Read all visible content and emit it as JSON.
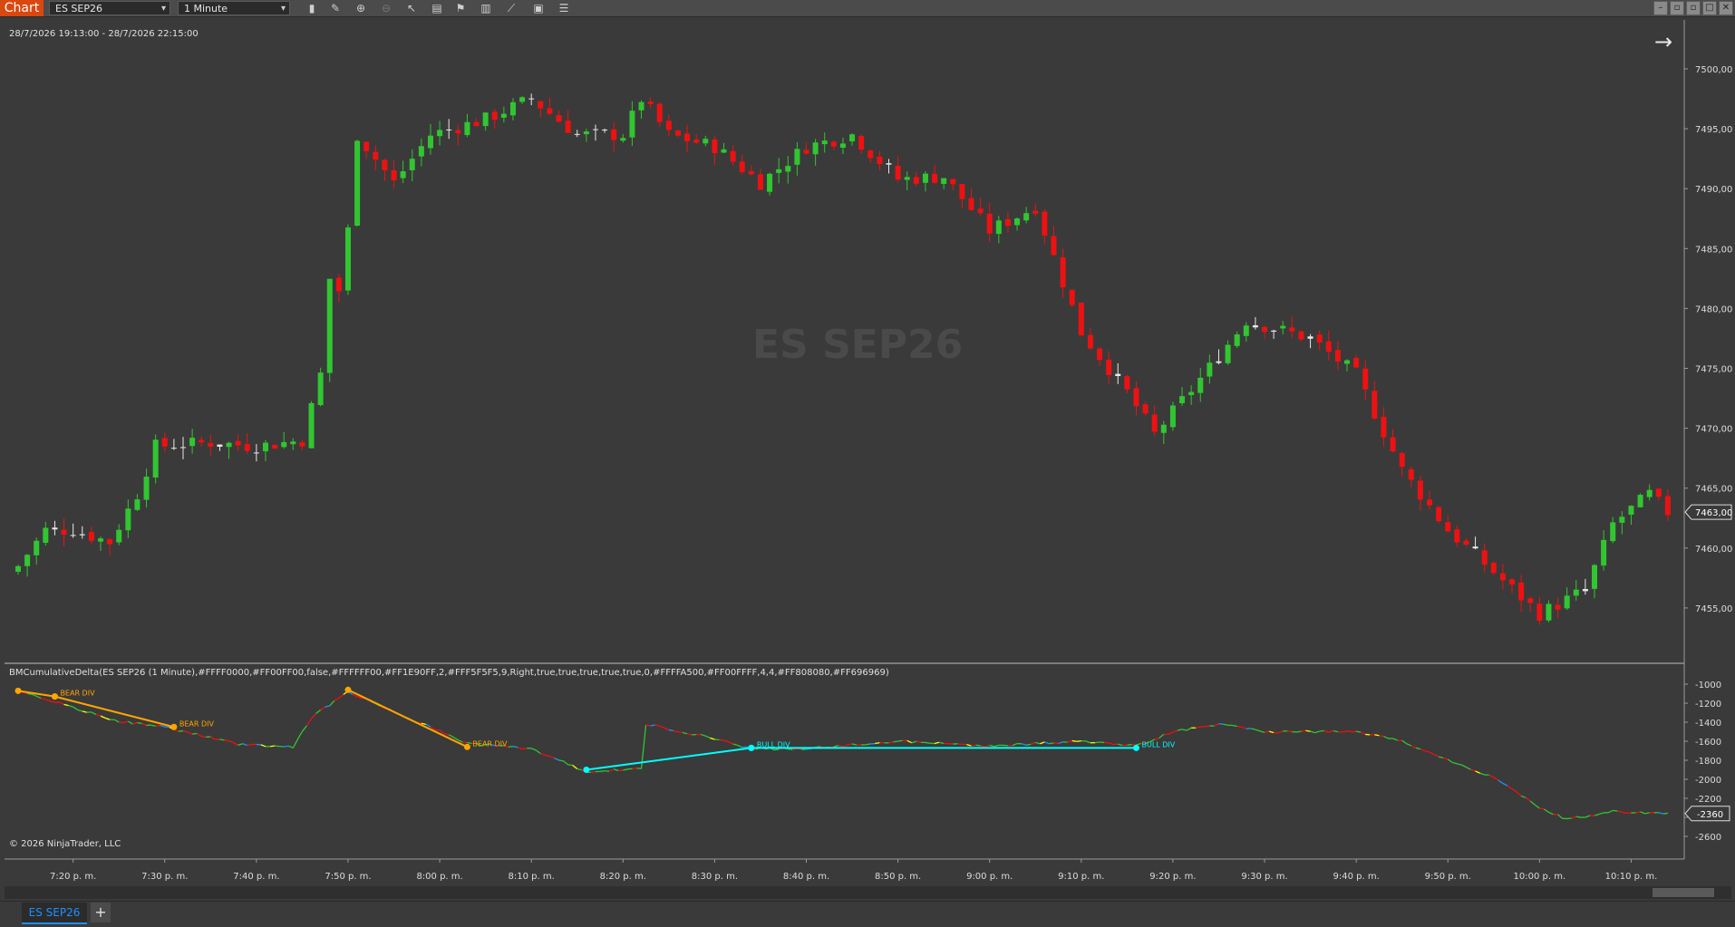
{
  "toolbar": {
    "brand": "Chart",
    "instrument": "ES SEP26",
    "interval": "1 Minute",
    "icons": [
      "bar-type-icon",
      "pencil-icon",
      "zoom-in-icon",
      "zoom-out-icon",
      "cursor-icon",
      "properties-icon",
      "templates-icon",
      "indicators-icon",
      "strategies-icon",
      "chart-trader-icon",
      "data-box-icon"
    ]
  },
  "chart": {
    "date_range": "28/7/2026 19:13:00 - 28/7/2026 22:15:00",
    "watermark": "ES SEP26",
    "current_price": "7463,00",
    "price_ticks": [
      "7500,00",
      "7495,00",
      "7490,00",
      "7485,00",
      "7480,00",
      "7475,00",
      "7470,00",
      "7465,00",
      "7460,00",
      "7455,00"
    ],
    "time_ticks": [
      "7:20 p. m.",
      "7:30 p. m.",
      "7:40 p. m.",
      "7:50 p. m.",
      "8:00 p. m.",
      "8:10 p. m.",
      "8:20 p. m.",
      "8:30 p. m.",
      "8:40 p. m.",
      "8:50 p. m.",
      "9:00 p. m.",
      "9:10 p. m.",
      "9:20 p. m.",
      "9:30 p. m.",
      "9:40 p. m.",
      "9:50 p. m.",
      "10:00 p. m.",
      "10:10 p. m."
    ],
    "colors": {
      "up": "#31c631",
      "down": "#ee1111",
      "background": "#3a3a3a",
      "axis_text": "#dcdcdc"
    }
  },
  "indicator": {
    "label": "BMCumulativeDelta(ES SEP26 (1 Minute),#FFFF0000,#FF00FF00,false,#FFFFFF00,#FF1E90FF,2,#FFF5F5F5,9,Right,true,true,true,true,true,0,#FFFFA500,#FF00FFFF,4,4,#FF808080,#FF696969)",
    "current_value": "-2360",
    "ticks": [
      "-1000",
      "-1200",
      "-1400",
      "-1600",
      "-1800",
      "-2000",
      "-2200",
      "-2400",
      "-2600"
    ],
    "bear_div_label": "BEAR DIV",
    "bull_div_label": "BULL DIV",
    "colors": {
      "bear": "#ffa500",
      "bull": "#00ffff"
    }
  },
  "footer": {
    "copyright": "© 2026 NinjaTrader, LLC",
    "tab_label": "ES SEP26",
    "add_tab": "+"
  },
  "chart_data": {
    "type": "candlestick",
    "title": "ES SEP26",
    "x_range": [
      "7:14 p. m.",
      "10:15 p. m."
    ],
    "ylim": [
      7453,
      7502
    ],
    "close_path": [
      {
        "t": "7:14",
        "close": 7458.5
      },
      {
        "t": "7:17",
        "close": 7461.5
      },
      {
        "t": "7:20",
        "close": 7461.5
      },
      {
        "t": "7:24",
        "close": 7460.5
      },
      {
        "t": "7:27",
        "close": 7464.5
      },
      {
        "t": "7:29",
        "close": 7468.5
      },
      {
        "t": "7:35",
        "close": 7468.8
      },
      {
        "t": "7:40",
        "close": 7468.5
      },
      {
        "t": "7:45",
        "close": 7469.0
      },
      {
        "t": "7:47",
        "close": 7474.5
      },
      {
        "t": "7:48",
        "close": 7482.5
      },
      {
        "t": "7:49",
        "close": 7481.5
      },
      {
        "t": "7:50",
        "close": 7486.5
      },
      {
        "t": "7:51",
        "close": 7494.5
      },
      {
        "t": "7:55",
        "close": 7490.5
      },
      {
        "t": "7:59",
        "close": 7494.5
      },
      {
        "t": "8:05",
        "close": 7495.8
      },
      {
        "t": "8:10",
        "close": 7497.5
      },
      {
        "t": "8:15",
        "close": 7494.5
      },
      {
        "t": "8:20",
        "close": 7494.5
      },
      {
        "t": "8:22",
        "close": 7497.5
      },
      {
        "t": "8:25",
        "close": 7494.5
      },
      {
        "t": "8:30",
        "close": 7493.5
      },
      {
        "t": "8:35",
        "close": 7490.5
      },
      {
        "t": "8:40",
        "close": 7493.5
      },
      {
        "t": "8:45",
        "close": 7494.5
      },
      {
        "t": "8:50",
        "close": 7490.8
      },
      {
        "t": "8:55",
        "close": 7491.0
      },
      {
        "t": "9:00",
        "close": 7486.5
      },
      {
        "t": "9:05",
        "close": 7488.5
      },
      {
        "t": "9:10",
        "close": 7478.0
      },
      {
        "t": "9:15",
        "close": 7473.0
      },
      {
        "t": "9:18",
        "close": 7469.5
      },
      {
        "t": "9:25",
        "close": 7476.0
      },
      {
        "t": "9:28",
        "close": 7479.0
      },
      {
        "t": "9:35",
        "close": 7477.5
      },
      {
        "t": "9:40",
        "close": 7474.5
      },
      {
        "t": "9:45",
        "close": 7466.5
      },
      {
        "t": "9:50",
        "close": 7461.5
      },
      {
        "t": "9:55",
        "close": 7458.0
      },
      {
        "t": "10:00",
        "close": 7454.5
      },
      {
        "t": "10:05",
        "close": 7456.5
      },
      {
        "t": "10:08",
        "close": 7462.0
      },
      {
        "t": "10:12",
        "close": 7464.5
      },
      {
        "t": "10:14",
        "close": 7463.0
      }
    ],
    "indicator_series": {
      "name": "BMCumulativeDelta",
      "ylim": [
        -2700,
        -900
      ],
      "path": [
        {
          "t": "7:14",
          "v": -1060
        },
        {
          "t": "7:20",
          "v": -1250
        },
        {
          "t": "7:25",
          "v": -1390
        },
        {
          "t": "7:30",
          "v": -1450
        },
        {
          "t": "7:38",
          "v": -1630
        },
        {
          "t": "7:44",
          "v": -1660
        },
        {
          "t": "7:46",
          "v": -1350
        },
        {
          "t": "7:50",
          "v": -1080
        },
        {
          "t": "8:03",
          "v": -1620
        },
        {
          "t": "8:10",
          "v": -1680
        },
        {
          "t": "8:16",
          "v": -1920
        },
        {
          "t": "8:22",
          "v": -1890
        },
        {
          "t": "8:22.5",
          "v": -1420
        },
        {
          "t": "8:30",
          "v": -1570
        },
        {
          "t": "8:34",
          "v": -1680
        },
        {
          "t": "8:40",
          "v": -1680
        },
        {
          "t": "8:50",
          "v": -1600
        },
        {
          "t": "9:00",
          "v": -1650
        },
        {
          "t": "9:10",
          "v": -1600
        },
        {
          "t": "9:16",
          "v": -1650
        },
        {
          "t": "9:20",
          "v": -1500
        },
        {
          "t": "9:25",
          "v": -1420
        },
        {
          "t": "9:30",
          "v": -1500
        },
        {
          "t": "9:40",
          "v": -1500
        },
        {
          "t": "9:45",
          "v": -1600
        },
        {
          "t": "9:50",
          "v": -1800
        },
        {
          "t": "9:55",
          "v": -1980
        },
        {
          "t": "10:00",
          "v": -2300
        },
        {
          "t": "10:03",
          "v": -2420
        },
        {
          "t": "10:08",
          "v": -2340
        },
        {
          "t": "10:14",
          "v": -2360
        }
      ]
    }
  }
}
